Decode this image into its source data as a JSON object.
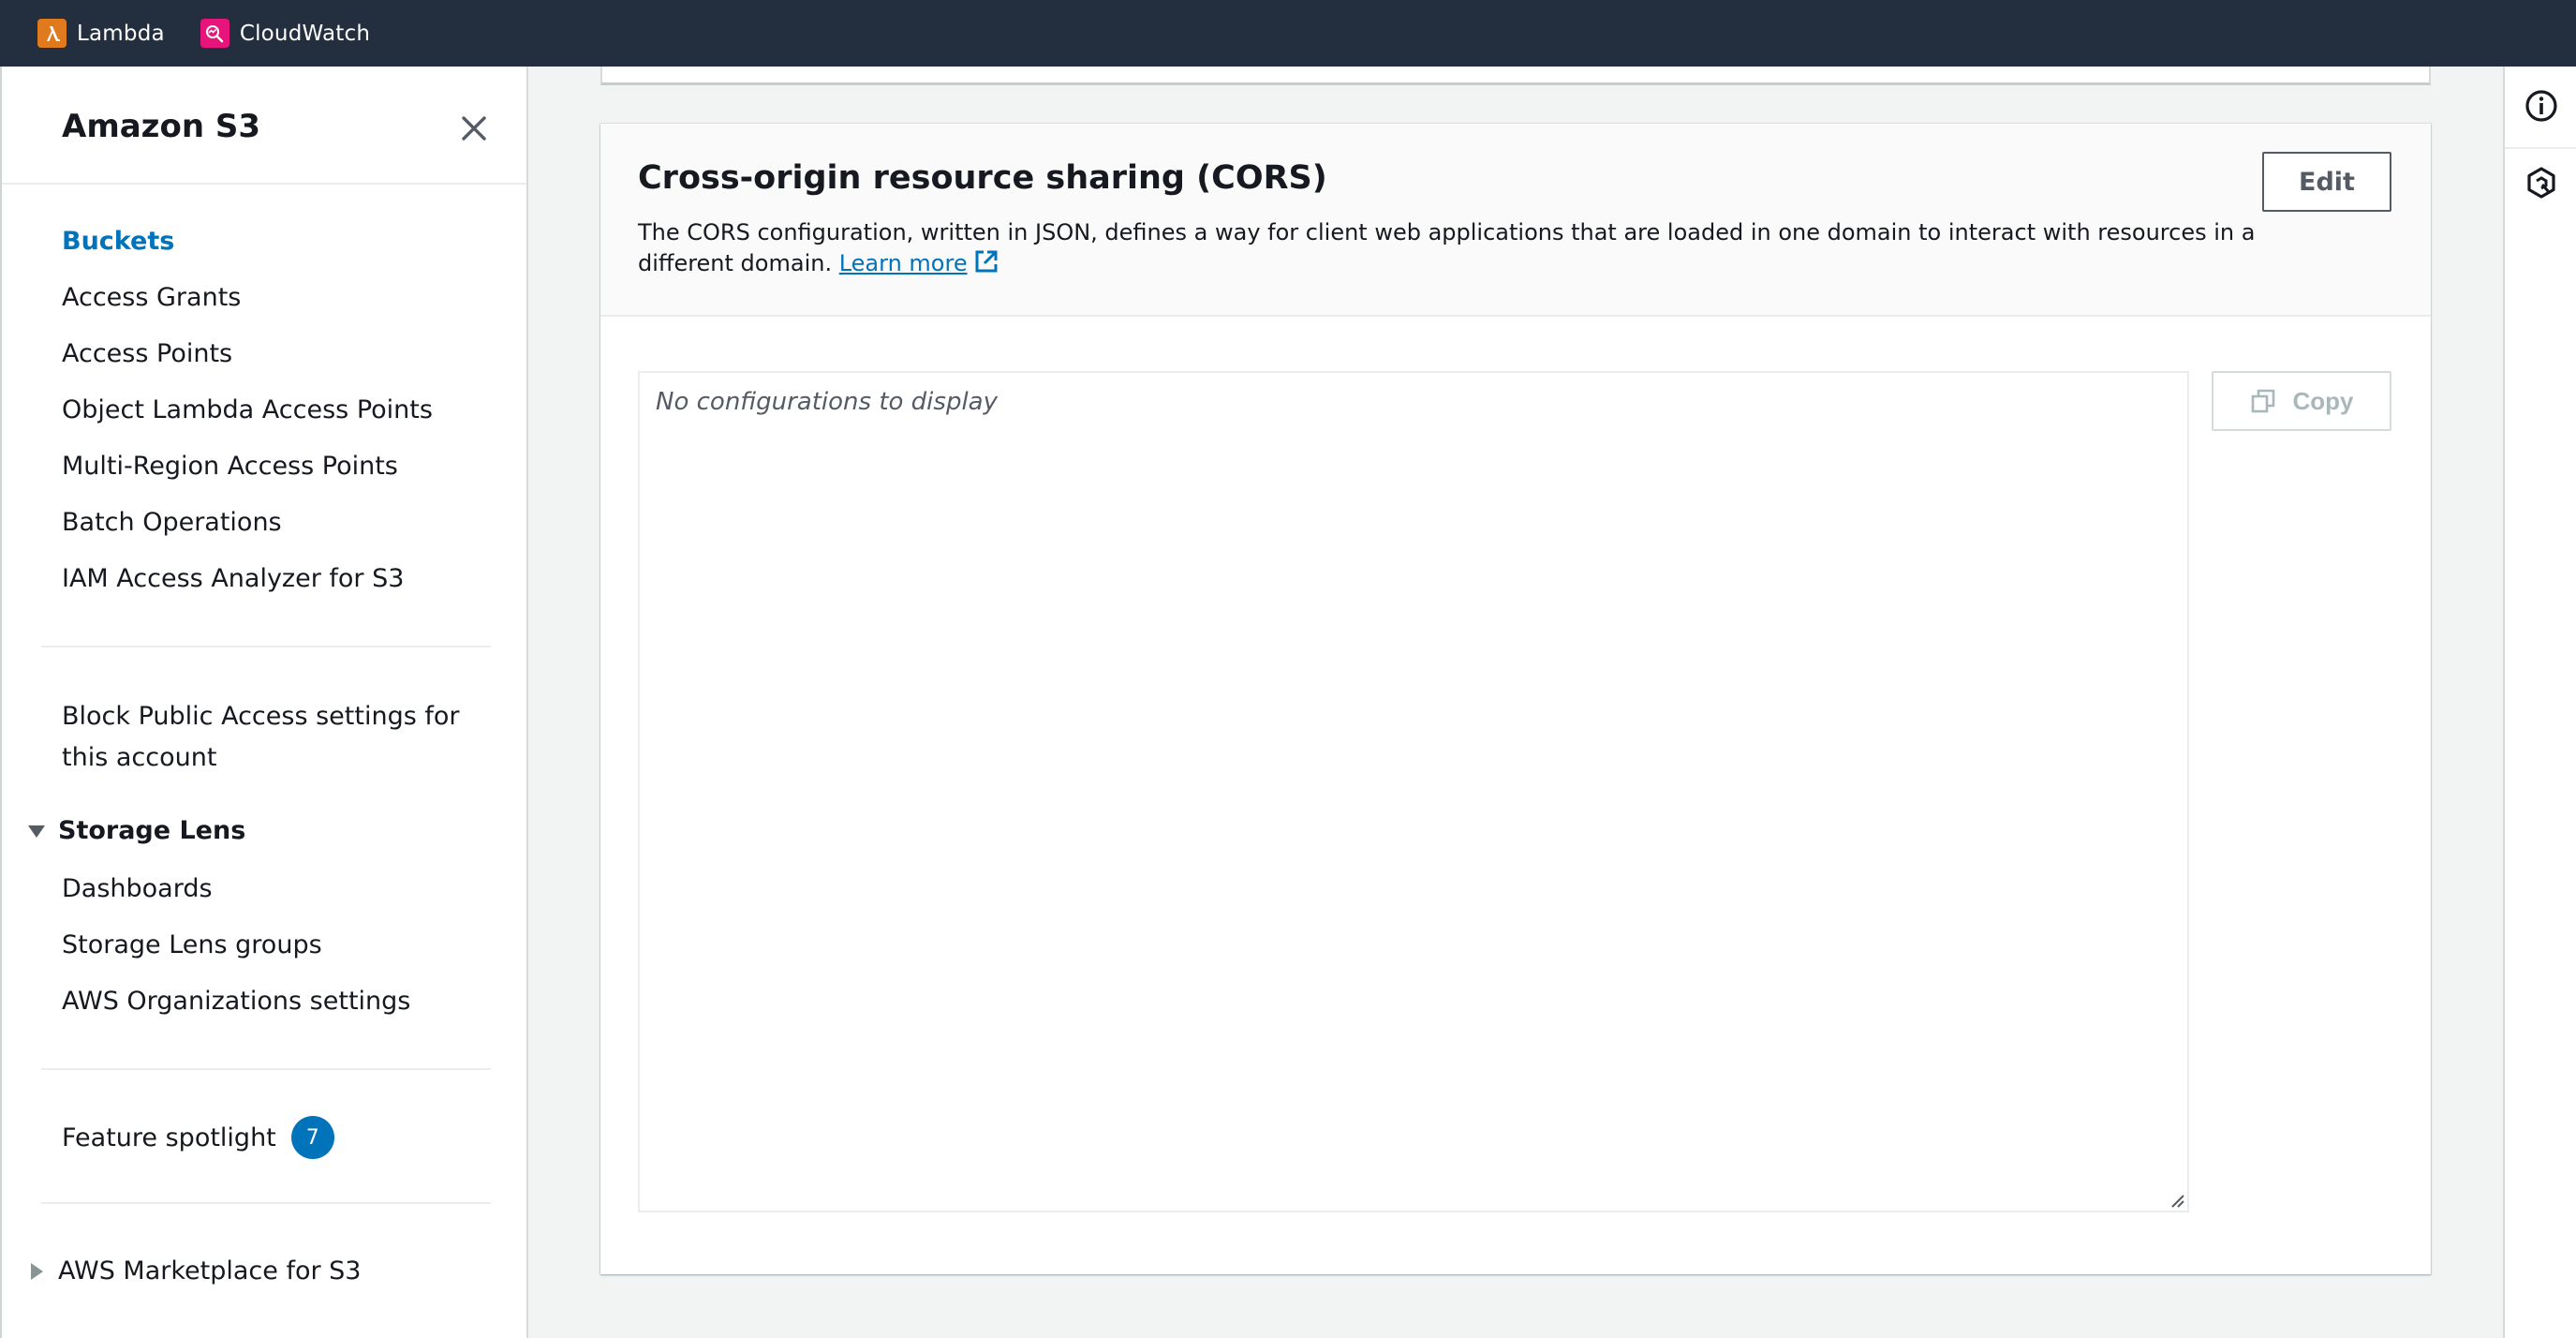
{
  "topbar": {
    "services": [
      {
        "label": "Lambda",
        "icon": "lambda-icon",
        "color": "#e07a1f"
      },
      {
        "label": "CloudWatch",
        "icon": "cloudwatch-icon",
        "color": "#e7157b"
      }
    ]
  },
  "sidebar": {
    "title": "Amazon S3",
    "items": [
      {
        "label": "Buckets",
        "active": true
      },
      {
        "label": "Access Grants"
      },
      {
        "label": "Access Points"
      },
      {
        "label": "Object Lambda Access Points"
      },
      {
        "label": "Multi-Region Access Points"
      },
      {
        "label": "Batch Operations"
      },
      {
        "label": "IAM Access Analyzer for S3"
      }
    ],
    "block_public_access": {
      "line1": "Block Public Access settings for",
      "line2": "this account"
    },
    "storage_lens": {
      "label": "Storage Lens",
      "expanded": true,
      "items": [
        "Dashboards",
        "Storage Lens groups",
        "AWS Organizations settings"
      ]
    },
    "feature_spotlight": {
      "label": "Feature spotlight",
      "badge": "7"
    },
    "marketplace": {
      "label": "AWS Marketplace for S3",
      "expanded": false
    }
  },
  "panel": {
    "title": "Cross-origin resource sharing (CORS)",
    "description": "The CORS configuration, written in JSON, defines a way for client web applications that are loaded in one domain to interact with resources in a different domain. ",
    "learn_more": "Learn more",
    "edit_label": "Edit",
    "code_placeholder": "No configurations to display",
    "copy_label": "Copy"
  },
  "colors": {
    "accent": "#0073bb",
    "topbar": "#232f3e"
  }
}
